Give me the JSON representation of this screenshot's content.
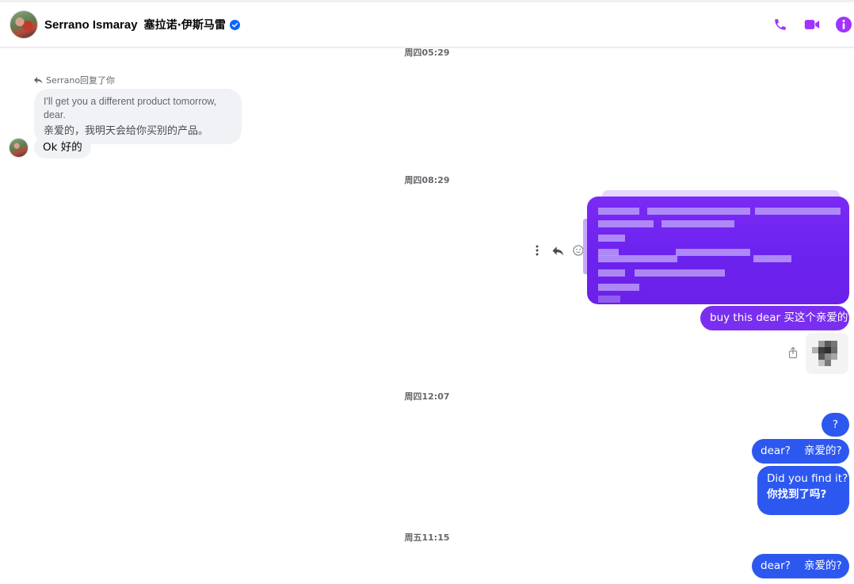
{
  "header": {
    "contact_name_en": "Serrano Ismaray",
    "contact_name_cn": "塞拉诺·伊斯马雷",
    "verified_icon": "verified-badge-icon",
    "actions": [
      {
        "name": "call",
        "icon": "phone-icon"
      },
      {
        "name": "video-call",
        "icon": "video-icon"
      },
      {
        "name": "conversation-info",
        "icon": "info-icon"
      }
    ],
    "accent_color": "#a033ff"
  },
  "timestamps": {
    "t1": "周四05:29",
    "t2": "周四08:29",
    "t3": "周四12:07",
    "t4": "周五11:15"
  },
  "incoming": {
    "reply_label": "Serrano回复了你",
    "quoted_en": "I'll get you a different product tomorrow, dear.",
    "quoted_cn": "亲爱的，我明天会给你买别的产品。",
    "message": "Ok  好的"
  },
  "outgoing": {
    "buy_msg": "buy this dear  买这个亲爱的",
    "q_msg": "?",
    "dear_msg_1": "dear?    亲爱的?",
    "find_en": "Did you find it?",
    "find_cn": "你找到了吗?",
    "dear_msg_2": "dear?    亲爱的?"
  },
  "colors": {
    "purple_bubble": "#7a2ff0",
    "blue_bubble": "#2d58f0",
    "incoming_bubble": "#f0f2f5"
  }
}
